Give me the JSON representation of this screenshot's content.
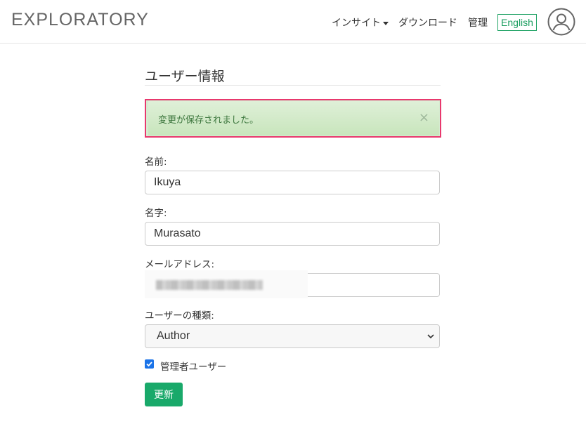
{
  "navbar": {
    "brand": "EXPLORATORY",
    "insight": "インサイト",
    "download": "ダウンロード",
    "admin": "管理",
    "language": "English",
    "language_color": "#1a9d5f"
  },
  "page": {
    "title": "ユーザー情報"
  },
  "alert": {
    "message": "変更が保存されました。",
    "close": "×",
    "highlight_color": "#e8386d"
  },
  "form": {
    "first_name_label": "名前:",
    "first_name_value": "Ikuya",
    "last_name_label": "名字:",
    "last_name_value": "Murasato",
    "email_label": "メールアドレス:",
    "user_type_label": "ユーザーの種類:",
    "user_type_value": "Author",
    "admin_checkbox_label": "管理者ユーザー",
    "admin_checked": true,
    "submit_label": "更新",
    "submit_color": "#19a96a"
  }
}
